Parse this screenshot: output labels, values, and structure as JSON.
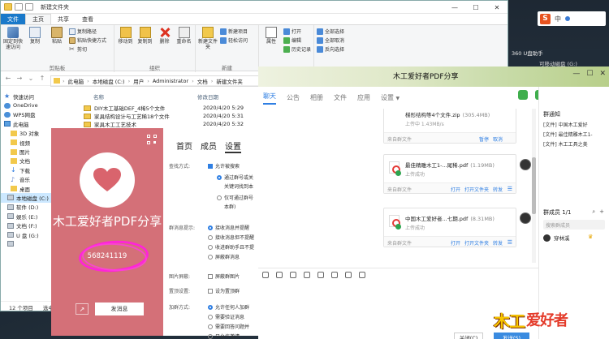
{
  "desktop": {
    "ime_label": "中",
    "side_label_1": "360 U盘助手",
    "side_label_2": "可移动磁盘 (G:)",
    "brand_left": "木工",
    "brand_right": "爱好者"
  },
  "explorer": {
    "title": "新建文件夹",
    "tabs": [
      "文件",
      "主页",
      "共享",
      "查看"
    ],
    "ribbon": {
      "clipboard": {
        "label": "剪贴板",
        "pin": "固定到快速访问",
        "copy": "复制",
        "paste": "粘贴",
        "copy_path": "复制路径",
        "paste_shortcut": "粘贴快捷方式",
        "cut": "剪切"
      },
      "organize": {
        "label": "组织",
        "move_to": "移动到",
        "copy_to": "复制到",
        "delete": "删除",
        "rename": "重命名"
      },
      "new": {
        "label": "新建",
        "new_folder": "新建文件夹",
        "new_item": "新建项目",
        "easy_access": "轻松访问"
      },
      "open": {
        "properties": "属性",
        "open": "打开",
        "edit": "编辑",
        "history": "历史记录"
      },
      "select": {
        "select_all": "全部选择",
        "select_none": "全部取消",
        "invert": "反向选择"
      }
    },
    "address": {
      "parts": [
        "此电脑",
        "本地磁盘 (C:)",
        "用户",
        "Administrator",
        "文档",
        "新建文件夹"
      ]
    },
    "nav_items": [
      {
        "label": "快速访问",
        "icon": "star-icon"
      },
      {
        "label": "OneDrive",
        "icon": "cloud-icon"
      },
      {
        "label": "WPS网盘",
        "icon": "cloud-icon"
      },
      {
        "label": "此电脑",
        "icon": "pc-icon"
      },
      {
        "label": "3D 对象",
        "icon": "folder-icon"
      },
      {
        "label": "视频",
        "icon": "folder-icon"
      },
      {
        "label": "图片",
        "icon": "folder-icon"
      },
      {
        "label": "文档",
        "icon": "folder-icon"
      },
      {
        "label": "下载",
        "icon": "download-icon"
      },
      {
        "label": "音乐",
        "icon": "music-icon"
      },
      {
        "label": "桌面",
        "icon": "folder-icon"
      },
      {
        "label": "本地磁盘 (C:)",
        "icon": "drive-icon"
      },
      {
        "label": "软件 (D:)",
        "icon": "drive-icon"
      },
      {
        "label": "娱乐 (E:)",
        "icon": "drive-icon"
      },
      {
        "label": "文档 (F:)",
        "icon": "drive-icon"
      },
      {
        "label": "U 盘 (G:)",
        "icon": "drive-icon"
      },
      {
        "label": "",
        "icon": "drive-icon"
      }
    ],
    "columns": {
      "name": "名称",
      "modified": "修改日期"
    },
    "files": [
      {
        "name": "DIY木工基础DEF_4稀5个文件",
        "date": "2020/4/20 5:29"
      },
      {
        "name": "家具结构设计与工艺稀18个文件",
        "date": "2020/4/20 5:31"
      },
      {
        "name": "家具木工工艺技术",
        "date": "2020/4/20 5:32"
      }
    ],
    "status": {
      "count": "12 个项目",
      "selected": "选中"
    }
  },
  "group_card": {
    "name": "木工爱好者PDF分享",
    "number": "568241119",
    "send_button": "发消息"
  },
  "settings": {
    "tabs": [
      "首页",
      "成员",
      "设置"
    ],
    "search_label": "查找方式:",
    "allow_search": "允许被搜索",
    "search_opt_1": "通过群号或关",
    "search_opt_1b": "关键词找到本",
    "search_opt_2": "仅可通过群号",
    "search_opt_2b": "本群)",
    "notify_label": "群消息提示:",
    "notify_opts": [
      "接收消息并提醒",
      "接收消息但不提醒",
      "收进群助手且不提",
      "屏蔽群消息"
    ],
    "pic_label": "图片屏蔽:",
    "pic_opt": "屏蔽群图片",
    "top_label": "置顶设置:",
    "top_opt": "设为置顶群",
    "join_label": "加群方式:",
    "join_opts": [
      "允许任何人加群",
      "需要验证消息",
      "需要回答问题并",
      "只允许邀请"
    ]
  },
  "qq": {
    "title": "木工爱好者PDF分享",
    "tabs": [
      "聊天",
      "公告",
      "相册",
      "文件",
      "应用",
      "设置"
    ],
    "files": [
      {
        "name": "梯形结构等4个文件.zip",
        "size": "(305.4MB)",
        "status": "上传中 1.43MB/s",
        "source": "来自群文件",
        "actions": [
          "暂停",
          "取消"
        ],
        "menu": ""
      },
      {
        "name": "最佳精雕木工1-...尾稀.pdf",
        "size": "(1.19MB)",
        "status": "上传成功",
        "source": "来自群文件",
        "actions": [
          "打开",
          "打开文件夹",
          "转发"
        ],
        "menu": "☰"
      },
      {
        "name": "中国木工爱好者...七期.pdf",
        "size": "(8.31MB)",
        "status": "上传成功",
        "source": "来自群文件",
        "actions": [
          "打开",
          "打开文件夹",
          "转发"
        ],
        "menu": "☰"
      }
    ],
    "close_button": "关闭(C)",
    "send_button": "发送(S)",
    "side": {
      "notice_title": "群通知",
      "notices": [
        "[文件] 中国木工爱好",
        "[文件] 最佳精雕木工1-",
        "[文件] 木工工具之美"
      ],
      "member_title": "群成员 1/1",
      "member_search": "搜索群成员",
      "member_name": "穿林溪"
    }
  }
}
